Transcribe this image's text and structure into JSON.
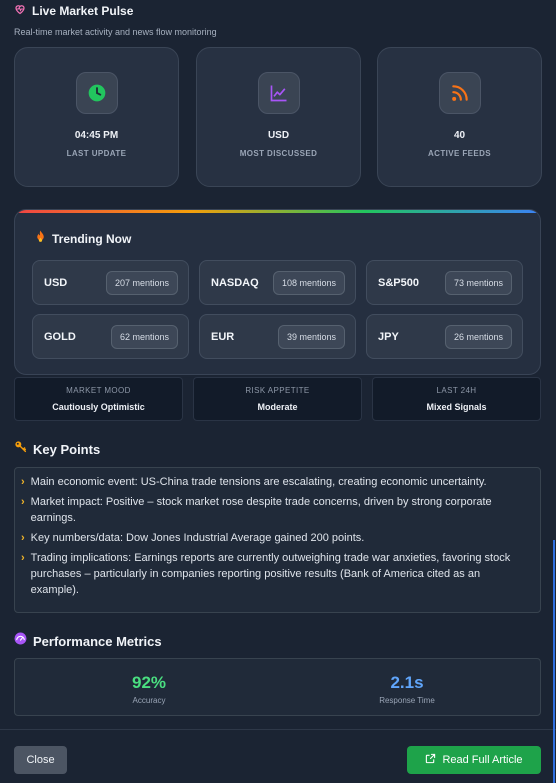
{
  "header": {
    "title": "Live Market Pulse",
    "subtitle": "Real-time market activity and news flow monitoring",
    "icon": "heart-pulse-icon"
  },
  "stats": [
    {
      "value": "04:45 PM",
      "label": "LAST UPDATE",
      "icon": "clock-icon",
      "color": "#22c55e"
    },
    {
      "value": "USD",
      "label": "MOST DISCUSSED",
      "icon": "chart-line-icon",
      "color": "#a855f7"
    },
    {
      "value": "40",
      "label": "ACTIVE FEEDS",
      "icon": "rss-icon",
      "color": "#f97316"
    }
  ],
  "trending": {
    "title": "Trending Now",
    "icon": "fire-icon",
    "items": [
      {
        "symbol": "USD",
        "count": "207 mentions"
      },
      {
        "symbol": "NASDAQ",
        "count": "108 mentions"
      },
      {
        "symbol": "S&P500",
        "count": "73 mentions"
      },
      {
        "symbol": "GOLD",
        "count": "62 mentions"
      },
      {
        "symbol": "EUR",
        "count": "39 mentions"
      },
      {
        "symbol": "JPY",
        "count": "26 mentions"
      }
    ]
  },
  "mood": [
    {
      "label": "MARKET MOOD",
      "value": "Cautiously Optimistic"
    },
    {
      "label": "RISK APPETITE",
      "value": "Moderate"
    },
    {
      "label": "LAST 24H",
      "value": "Mixed Signals"
    }
  ],
  "key_points": {
    "title": "Key Points",
    "icon": "key-icon",
    "items": [
      "Main economic event: US-China trade tensions are escalating, creating economic uncertainty.",
      "Market impact: Positive – stock market rose despite trade concerns, driven by strong corporate earnings.",
      "Key numbers/data: Dow Jones Industrial Average gained 200 points.",
      "Trading implications: Earnings reports are currently outweighing trade war anxieties, favoring stock purchases – particularly in companies reporting positive results (Bank of America cited as an example)."
    ]
  },
  "performance": {
    "title": "Performance Metrics",
    "icon": "gauge-icon",
    "accuracy": {
      "value": "92%",
      "label": "Accuracy",
      "color": "#4ade80"
    },
    "response": {
      "value": "2.1s",
      "label": "Response Time",
      "color": "#60a5fa"
    }
  },
  "footer": {
    "close_label": "Close",
    "read_label": "Read Full Article",
    "read_icon": "external-link-icon"
  }
}
